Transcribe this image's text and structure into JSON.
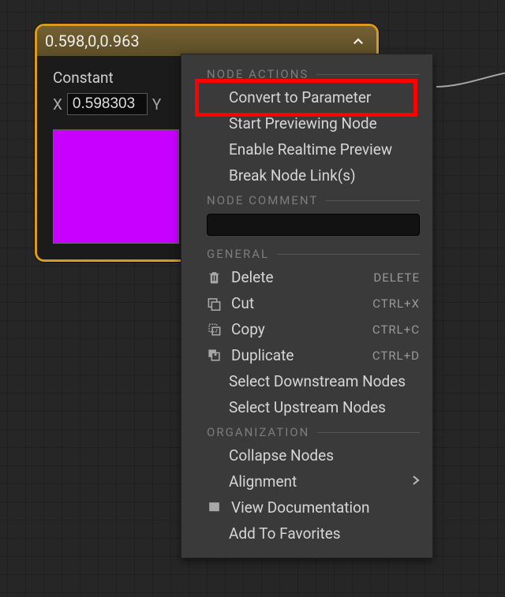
{
  "node": {
    "title": "0.598,0,0.963",
    "field_label": "Constant",
    "axis_x": "X",
    "axis_y": "Y",
    "value_x": "0.598303",
    "swatch_color": "#c800ff"
  },
  "menu": {
    "sections": {
      "node_actions": "NODE ACTIONS",
      "node_comment": "NODE COMMENT",
      "general": "GENERAL",
      "organization": "ORGANIZATION"
    },
    "items": {
      "convert_to_parameter": "Convert to Parameter",
      "start_previewing": "Start Previewing Node",
      "enable_realtime": "Enable Realtime Preview",
      "break_links": "Break Node Link(s)",
      "delete": "Delete",
      "cut": "Cut",
      "copy": "Copy",
      "duplicate": "Duplicate",
      "select_downstream": "Select Downstream Nodes",
      "select_upstream": "Select Upstream Nodes",
      "collapse": "Collapse Nodes",
      "alignment": "Alignment",
      "view_docs": "View Documentation",
      "add_fav": "Add To Favorites"
    },
    "shortcuts": {
      "delete": "DELETE",
      "cut": "CTRL+X",
      "copy": "CTRL+C",
      "duplicate": "CTRL+D"
    },
    "comment_value": ""
  }
}
